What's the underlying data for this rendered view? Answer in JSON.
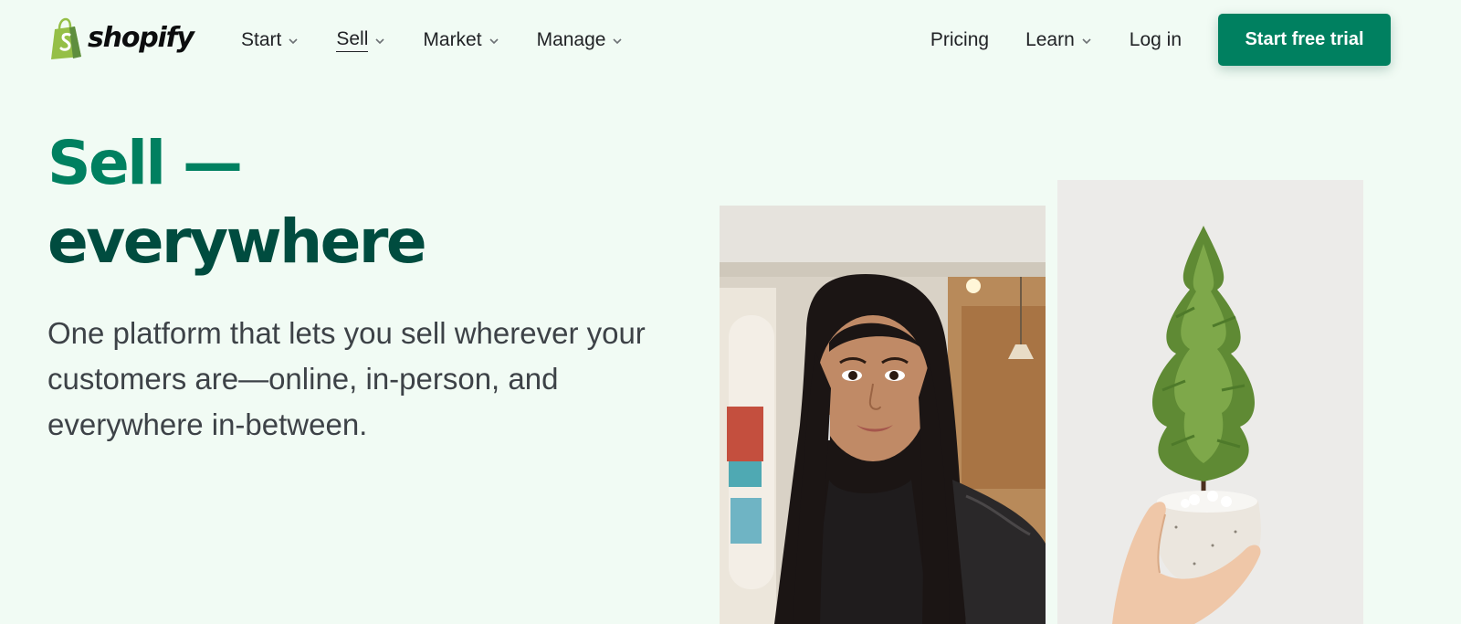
{
  "brand": {
    "name": "shopify",
    "accent": "#008060",
    "dark_accent": "#004c3f",
    "background": "#f1fbf4"
  },
  "nav": {
    "left": [
      {
        "label": "Start",
        "icon": "chevron-down-icon"
      },
      {
        "label": "Sell",
        "icon": "chevron-down-icon",
        "active": true
      },
      {
        "label": "Market",
        "icon": "chevron-down-icon"
      },
      {
        "label": "Manage",
        "icon": "chevron-down-icon"
      }
    ],
    "right": [
      {
        "label": "Pricing"
      },
      {
        "label": "Learn",
        "icon": "chevron-down-icon"
      },
      {
        "label": "Log in"
      }
    ],
    "cta_label": "Start free trial"
  },
  "hero": {
    "title_line1": "Sell —",
    "title_line2": "everywhere",
    "subtitle": "One platform that lets you sell wherever your customers are—online, in-person, and everywhere in-between."
  }
}
